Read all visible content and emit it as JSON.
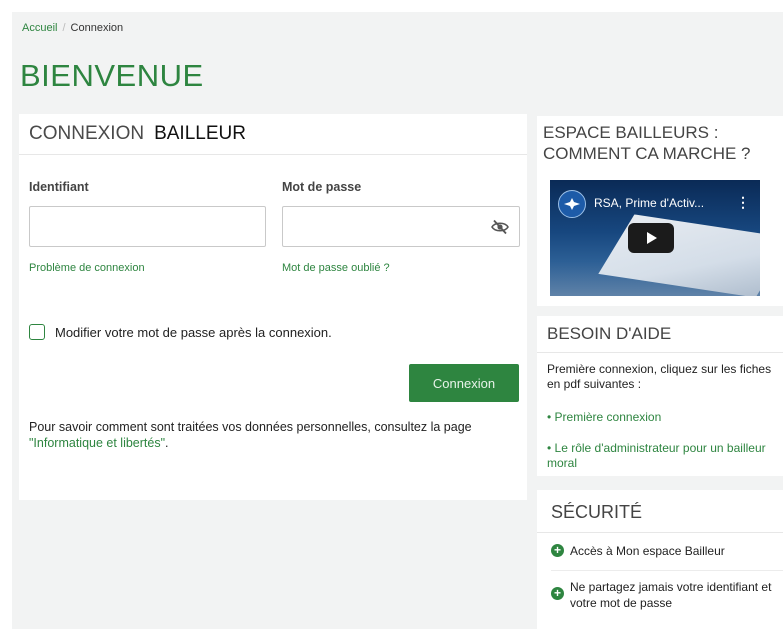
{
  "breadcrumb": {
    "home": "Accueil",
    "separator": "/",
    "current": "Connexion"
  },
  "page_title": "BIENVENUE",
  "login": {
    "title_part1": "CONNEXION",
    "title_part2": "BAILLEUR",
    "id_label": "Identifiant",
    "id_value": "",
    "password_label": "Mot de passe",
    "password_value": "",
    "problem_link": "Problème de connexion",
    "forgot_link": "Mot de passe oublié ?",
    "checkbox_label": "Modifier votre mot de passe après la connexion.",
    "checkbox_checked": false,
    "submit_label": "Connexion",
    "privacy_text": "Pour savoir comment sont traitées vos données personnelles, consultez la page ",
    "privacy_link": "\"Informatique et libertés\"",
    "privacy_end": "."
  },
  "espace": {
    "title_line1": "ESPACE BAILLEURS :",
    "title_line2": "COMMENT CA MARCHE ?",
    "video_title": "RSA, Prime d'Activ...",
    "video_menu": "⋮"
  },
  "aide": {
    "title": "BESOIN D'AIDE",
    "intro": "Première connexion, cliquez sur les fiches en pdf suivantes :",
    "links": [
      "• Première connexion",
      "• Le rôle d'administrateur pour un bailleur moral"
    ]
  },
  "securite": {
    "title": "SÉCURITÉ",
    "items": [
      "Accès à Mon espace Bailleur",
      "Ne partagez jamais votre identifiant et votre mot de passe"
    ]
  },
  "colors": {
    "accent": "#2e8540",
    "background": "#f2f3f3",
    "card": "#ffffff"
  },
  "icons": {
    "password_toggle": "eye-slash-icon",
    "video_channel": "channel-logo-icon",
    "play": "play-icon",
    "bullet": "plus-circle-icon"
  }
}
